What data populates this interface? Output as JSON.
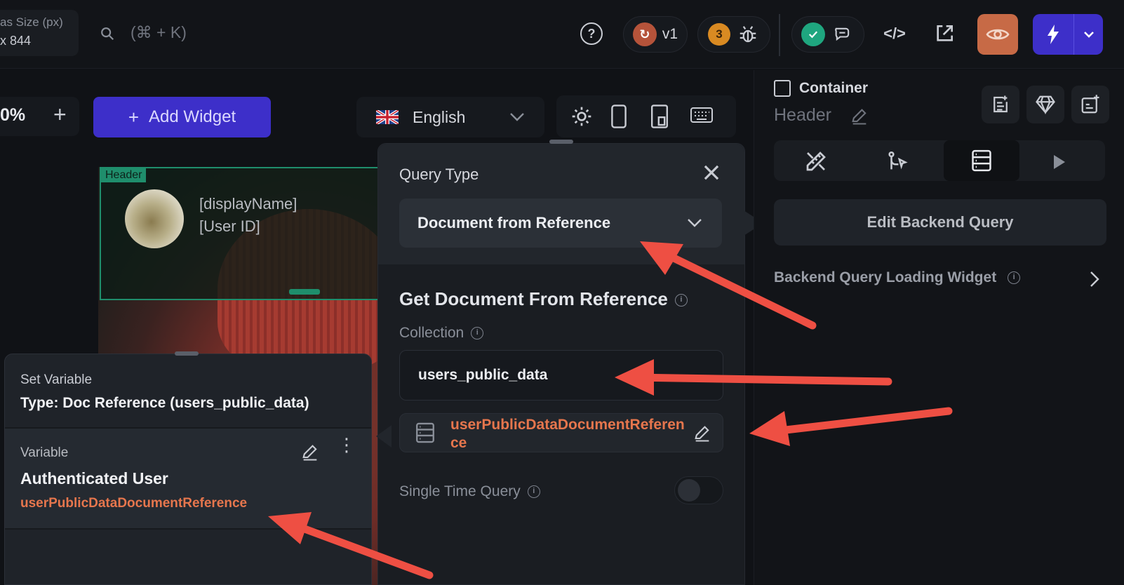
{
  "topbar": {
    "canvas_size_label": "as Size (px)",
    "canvas_size_value": "x 844",
    "search_shortcut": "(⌘ + K)",
    "version_label": "v1",
    "bug_count": "3"
  },
  "toolbar": {
    "zoom": "0%",
    "zoom_in": "+",
    "add_widget": "Add Widget",
    "language": "English"
  },
  "canvas": {
    "header_tag": "Header",
    "display_name": "[displayName]",
    "user_id": "[User ID]"
  },
  "query_panel": {
    "title": "Query Type",
    "query_type": "Document from Reference",
    "section_title": "Get Document From Reference",
    "collection_label": "Collection",
    "collection_value": "users_public_data",
    "reference_value": "userPublicDataDocumentReference",
    "single_time_label": "Single Time Query"
  },
  "set_variable": {
    "title": "Set Variable",
    "type": "Type: Doc Reference (users_public_data)",
    "variable_label": "Variable",
    "source": "Authenticated User",
    "field": "userPublicDataDocumentReference"
  },
  "right_panel": {
    "container_label": "Container",
    "widget_name": "Header",
    "edit_backend_query": "Edit Backend Query",
    "loading_widget": "Backend Query Loading Widget"
  },
  "colors": {
    "accent": "#3d2fc9",
    "orange": "#e6764d",
    "arrow": "#ee4f43",
    "preview": "#c76a46",
    "green": "#1fa67f"
  }
}
